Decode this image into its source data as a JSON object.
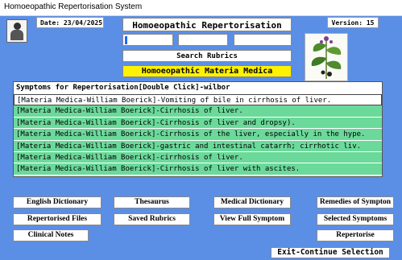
{
  "window": {
    "title": "Homoeopathic Repertorisation System"
  },
  "header": {
    "date": "Date: 23/04/2025",
    "app_title": "Homoeopathic Repertorisation",
    "version": "Version: 15"
  },
  "search": {
    "button_label": "Search Rubrics"
  },
  "materia_medica": {
    "label": "Homoeopathic Materia Medica"
  },
  "symptoms": {
    "header": "Symptoms for Repertorisation[Double Click]-wilbor",
    "rows": [
      {
        "text": "[Materia Medica-William Boerick]-Vomiting of bile in cirrhosis of liver.",
        "selected": false
      },
      {
        "text": "[Materia Medica-William Boerick]-Cirrhosis of liver.",
        "selected": true
      },
      {
        "text": "[Materia Medica-William Boerick]-Cirrhosis of liver and dropsy).",
        "selected": true
      },
      {
        "text": "[Materia Medica-William Boerick]-Cirrhosis of the liver, especially in the hype.",
        "selected": true
      },
      {
        "text": "[Materia Medica-William Boerick]-gastric  and intestinal catarrh; cirrhotic liv.",
        "selected": true
      },
      {
        "text": "[Materia Medica-William Boerick]-cirrhosis of liver.",
        "selected": true
      },
      {
        "text": "[Materia Medica-William Boerick]-Cirrhosis of liver with ascites.",
        "selected": true
      }
    ]
  },
  "buttons": {
    "english_dictionary": "English Dictionary",
    "thesaurus": "Thesaurus",
    "medical_dictionary": "Medical Dictionary",
    "remedies_of_symptom": "Remedies of Sympton",
    "repertorised_files": "Repertorised Files",
    "saved_rubrics": "Saved Rubrics",
    "view_full_symptom": "View Full Symptom",
    "selected_symptoms": "Selected Symptoms",
    "clinical_notes": "Clinical Notes",
    "repertorise": "Repertorise",
    "exit_continue": "Exit-Continue Selection"
  },
  "colors": {
    "background": "#5b8fe6",
    "selected_row": "#6bd99a",
    "materia_bar": "#fff200",
    "caret": "#1e66ff"
  },
  "icons": {
    "portrait": "portrait-icon",
    "plant": "herb-plant-illustration"
  }
}
